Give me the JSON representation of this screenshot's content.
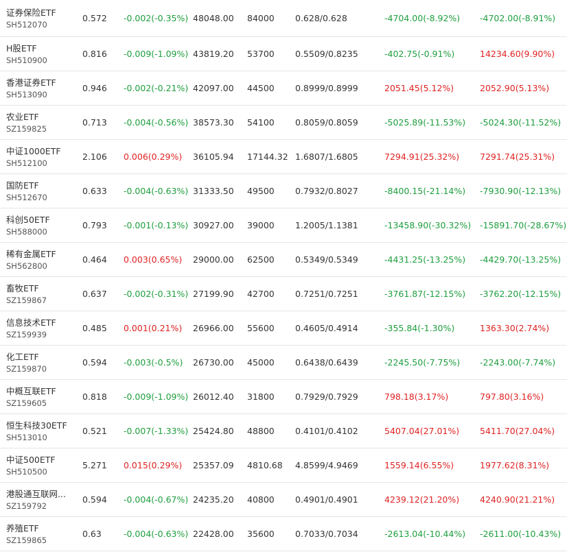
{
  "colors": {
    "up": "#e02222",
    "down": "#1e9e3e",
    "text": "#333333",
    "border": "#e6e6e6"
  },
  "rows": [
    {
      "name": "证券保险ETF",
      "code": "SH512070",
      "price": "0.572",
      "change": "-0.002(-0.35%)",
      "change_dir": "down",
      "amount": "48048.00",
      "shares": "84000",
      "nav": "0.628/0.628",
      "flow1": "-4704.00(-8.92%)",
      "flow1_dir": "down",
      "flow2": "-4702.00(-8.91%)",
      "flow2_dir": "down"
    },
    {
      "name": "H股ETF",
      "code": "SH510900",
      "price": "0.816",
      "change": "-0.009(-1.09%)",
      "change_dir": "down",
      "amount": "43819.20",
      "shares": "53700",
      "nav": "0.5509/0.8235",
      "flow1": "-402.75(-0.91%)",
      "flow1_dir": "down",
      "flow2": "14234.60(9.90%)",
      "flow2_dir": "up"
    },
    {
      "name": "香港证券ETF",
      "code": "SH513090",
      "price": "0.946",
      "change": "-0.002(-0.21%)",
      "change_dir": "down",
      "amount": "42097.00",
      "shares": "44500",
      "nav": "0.8999/0.8999",
      "flow1": "2051.45(5.12%)",
      "flow1_dir": "up",
      "flow2": "2052.90(5.13%)",
      "flow2_dir": "up"
    },
    {
      "name": "农业ETF",
      "code": "SZ159825",
      "price": "0.713",
      "change": "-0.004(-0.56%)",
      "change_dir": "down",
      "amount": "38573.30",
      "shares": "54100",
      "nav": "0.8059/0.8059",
      "flow1": "-5025.89(-11.53%)",
      "flow1_dir": "down",
      "flow2": "-5024.30(-11.52%)",
      "flow2_dir": "down"
    },
    {
      "name": "中证1000ETF",
      "code": "SH512100",
      "price": "2.106",
      "change": "0.006(0.29%)",
      "change_dir": "up",
      "amount": "36105.94",
      "shares": "17144.32",
      "nav": "1.6807/1.6805",
      "flow1": "7294.91(25.32%)",
      "flow1_dir": "up",
      "flow2": "7291.74(25.31%)",
      "flow2_dir": "up"
    },
    {
      "name": "国防ETF",
      "code": "SH512670",
      "price": "0.633",
      "change": "-0.004(-0.63%)",
      "change_dir": "down",
      "amount": "31333.50",
      "shares": "49500",
      "nav": "0.7932/0.8027",
      "flow1": "-8400.15(-21.14%)",
      "flow1_dir": "down",
      "flow2": "-7930.90(-12.13%)",
      "flow2_dir": "down"
    },
    {
      "name": "科创50ETF",
      "code": "SH588000",
      "price": "0.793",
      "change": "-0.001(-0.13%)",
      "change_dir": "down",
      "amount": "30927.00",
      "shares": "39000",
      "nav": "1.2005/1.1381",
      "flow1": "-13458.90(-30.32%)",
      "flow1_dir": "down",
      "flow2": "-15891.70(-28.67%)",
      "flow2_dir": "down"
    },
    {
      "name": "稀有金属ETF",
      "code": "SH562800",
      "price": "0.464",
      "change": "0.003(0.65%)",
      "change_dir": "up",
      "amount": "29000.00",
      "shares": "62500",
      "nav": "0.5349/0.5349",
      "flow1": "-4431.25(-13.25%)",
      "flow1_dir": "down",
      "flow2": "-4429.70(-13.25%)",
      "flow2_dir": "down"
    },
    {
      "name": "畜牧ETF",
      "code": "SZ159867",
      "price": "0.637",
      "change": "-0.002(-0.31%)",
      "change_dir": "down",
      "amount": "27199.90",
      "shares": "42700",
      "nav": "0.7251/0.7251",
      "flow1": "-3761.87(-12.15%)",
      "flow1_dir": "down",
      "flow2": "-3762.20(-12.15%)",
      "flow2_dir": "down"
    },
    {
      "name": "信息技术ETF",
      "code": "SZ159939",
      "price": "0.485",
      "change": "0.001(0.21%)",
      "change_dir": "up",
      "amount": "26966.00",
      "shares": "55600",
      "nav": "0.4605/0.4914",
      "flow1": "-355.84(-1.30%)",
      "flow1_dir": "down",
      "flow2": "1363.30(2.74%)",
      "flow2_dir": "up"
    },
    {
      "name": "化工ETF",
      "code": "SZ159870",
      "price": "0.594",
      "change": "-0.003(-0.5%)",
      "change_dir": "down",
      "amount": "26730.00",
      "shares": "45000",
      "nav": "0.6438/0.6439",
      "flow1": "-2245.50(-7.75%)",
      "flow1_dir": "down",
      "flow2": "-2243.00(-7.74%)",
      "flow2_dir": "down"
    },
    {
      "name": "中概互联ETF",
      "code": "SZ159605",
      "price": "0.818",
      "change": "-0.009(-1.09%)",
      "change_dir": "down",
      "amount": "26012.40",
      "shares": "31800",
      "nav": "0.7929/0.7929",
      "flow1": "798.18(3.17%)",
      "flow1_dir": "up",
      "flow2": "797.80(3.16%)",
      "flow2_dir": "up"
    },
    {
      "name": "恒生科技30ETF",
      "code": "SH513010",
      "price": "0.521",
      "change": "-0.007(-1.33%)",
      "change_dir": "down",
      "amount": "25424.80",
      "shares": "48800",
      "nav": "0.4101/0.4102",
      "flow1": "5407.04(27.01%)",
      "flow1_dir": "up",
      "flow2": "5411.70(27.04%)",
      "flow2_dir": "up"
    },
    {
      "name": "中证500ETF",
      "code": "SH510500",
      "price": "5.271",
      "change": "0.015(0.29%)",
      "change_dir": "up",
      "amount": "25357.09",
      "shares": "4810.68",
      "nav": "4.8599/4.9469",
      "flow1": "1559.14(6.55%)",
      "flow1_dir": "up",
      "flow2": "1977.62(8.31%)",
      "flow2_dir": "up"
    },
    {
      "name": "港股通互联网...",
      "code": "SZ159792",
      "price": "0.594",
      "change": "-0.004(-0.67%)",
      "change_dir": "down",
      "amount": "24235.20",
      "shares": "40800",
      "nav": "0.4901/0.4901",
      "flow1": "4239.12(21.20%)",
      "flow1_dir": "up",
      "flow2": "4240.90(21.21%)",
      "flow2_dir": "up"
    },
    {
      "name": "养殖ETF",
      "code": "SZ159865",
      "price": "0.63",
      "change": "-0.004(-0.63%)",
      "change_dir": "down",
      "amount": "22428.00",
      "shares": "35600",
      "nav": "0.7033/0.7034",
      "flow1": "-2613.04(-10.44%)",
      "flow1_dir": "down",
      "flow2": "-2611.00(-10.43%)",
      "flow2_dir": "down"
    }
  ]
}
